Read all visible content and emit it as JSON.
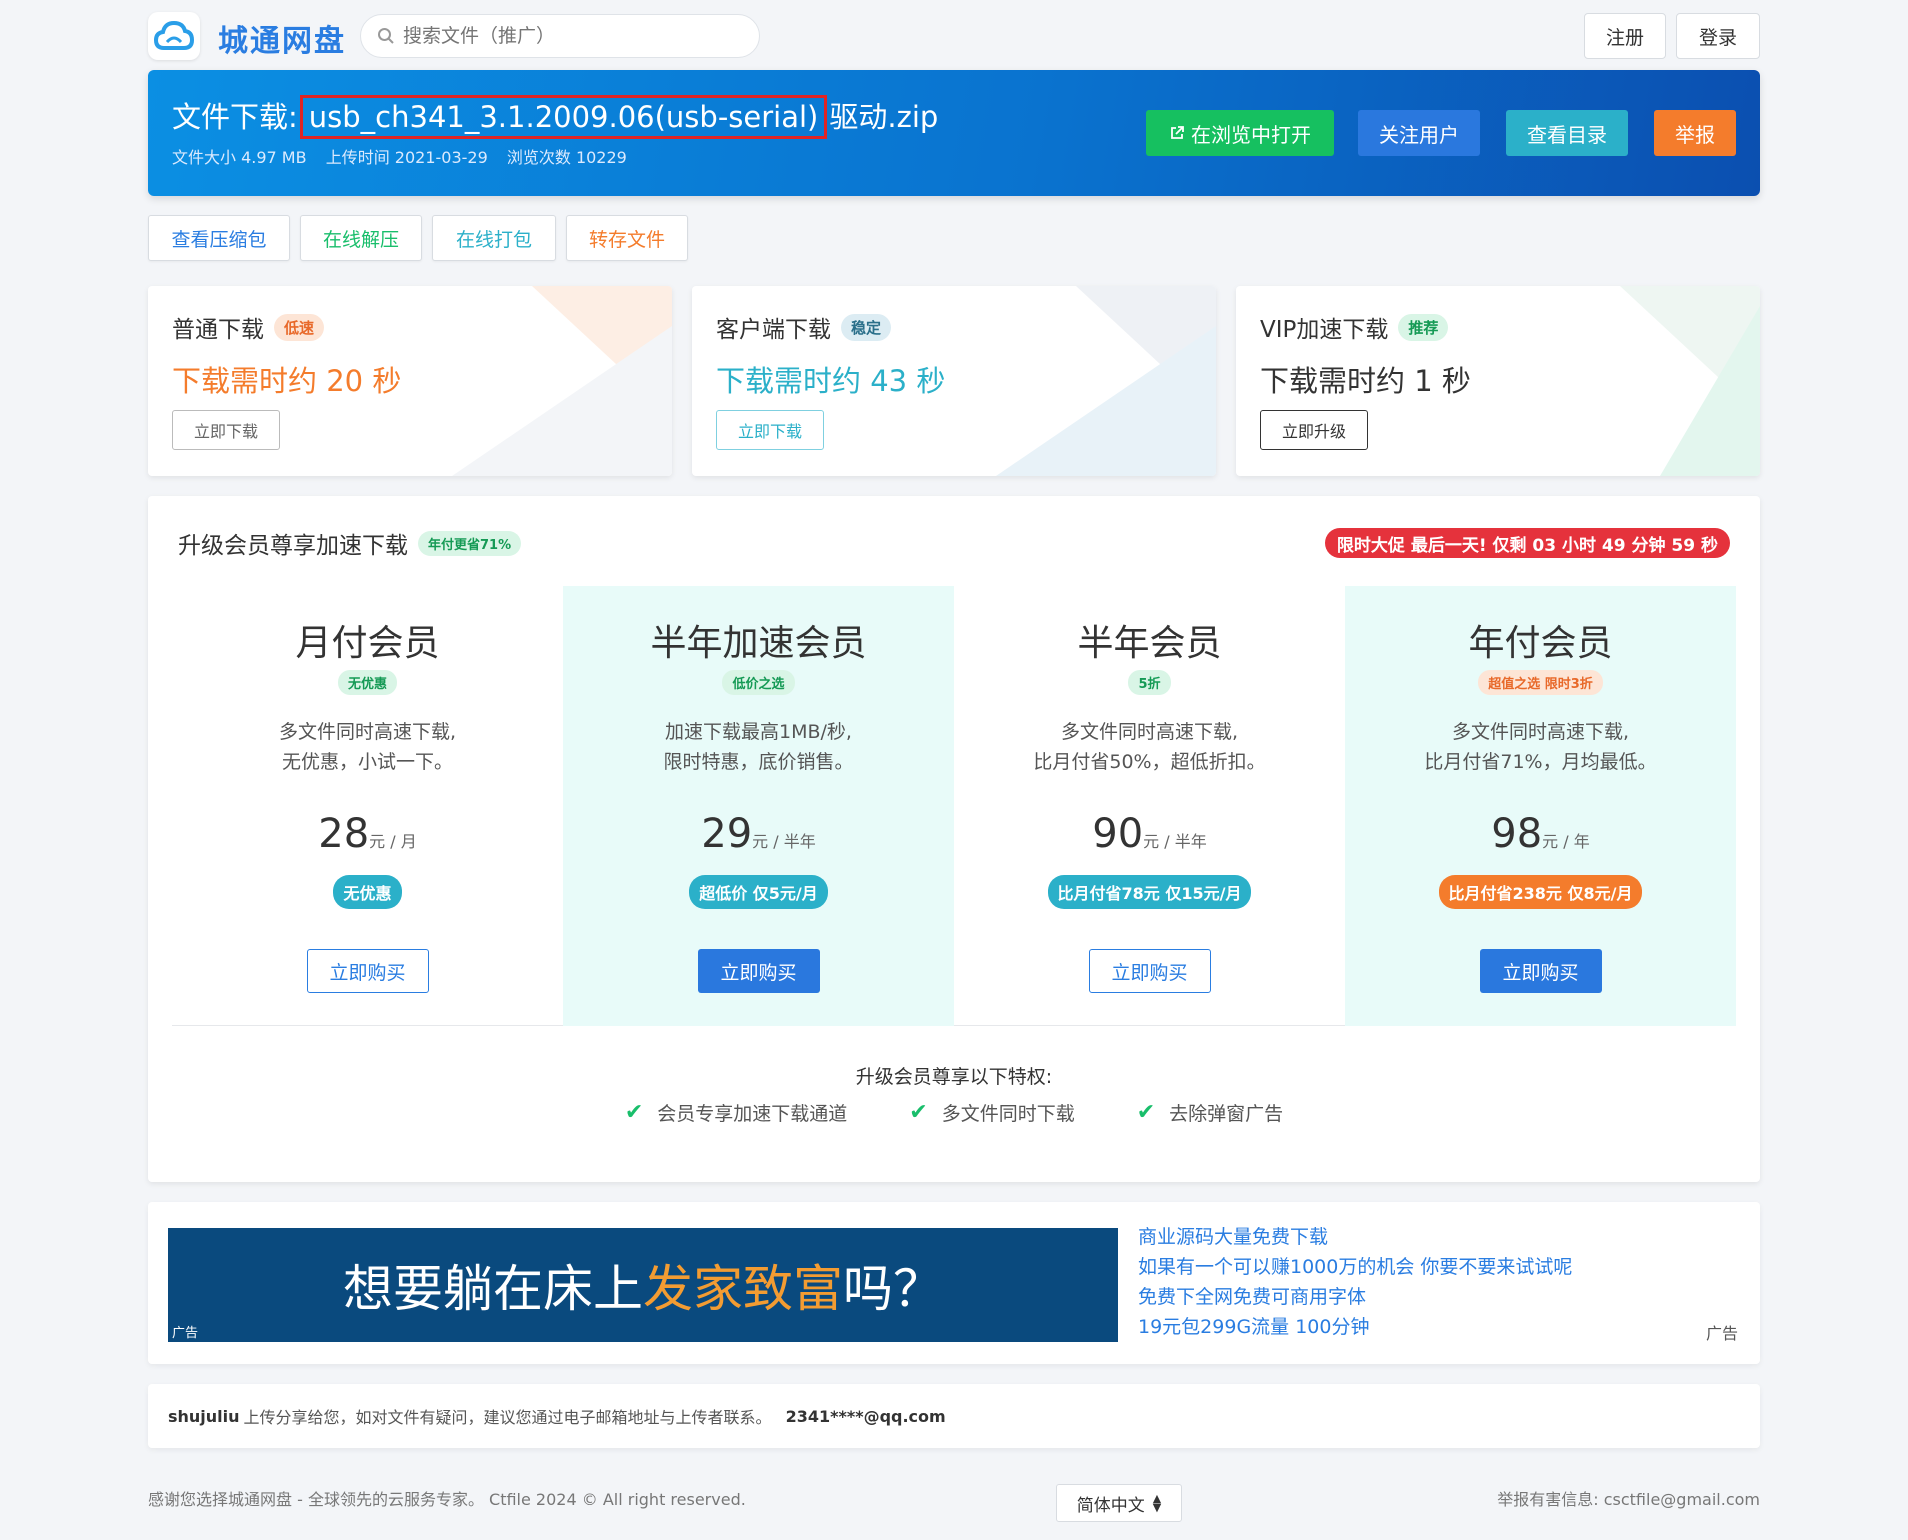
{
  "header": {
    "brand": "城通网盘",
    "search_placeholder": "搜索文件（推广）",
    "register": "注册",
    "login": "登录"
  },
  "file": {
    "title_prefix": "文件下载:",
    "name_highlight": "usb_ch341_3.1.2009.06(usb-serial)",
    "name_suffix": "驱动.zip",
    "size": "文件大小 4.97 MB",
    "upload_time": "上传时间 2021-03-29",
    "views": "浏览次数 10229"
  },
  "banner_buttons": {
    "open_browser": "在浏览中打开",
    "follow": "关注用户",
    "catalog": "查看目录",
    "report": "举报"
  },
  "tools": [
    "查看压缩包",
    "在线解压",
    "在线打包",
    "转存文件"
  ],
  "download_cards": [
    {
      "title": "普通下载",
      "tag": "低速",
      "time": "下载需时约 20 秒",
      "button": "立即下载"
    },
    {
      "title": "客户端下载",
      "tag": "稳定",
      "time": "下载需时约 43 秒",
      "button": "立即下载"
    },
    {
      "title": "VIP加速下载",
      "tag": "推荐",
      "time": "下载需时约 1 秒",
      "button": "立即升级"
    }
  ],
  "membership": {
    "title": "升级会员尊享加速下载",
    "title_tag": "年付更省71%",
    "promo": "限时大促 最后一天! 仅剩 03 小时 49 分钟 59 秒",
    "plans": [
      {
        "name": "月付会员",
        "tag": "无优惠",
        "desc1": "多文件同时高速下载,",
        "desc2": "无优惠，小试一下。",
        "price": "28",
        "unit": "元 / 月",
        "badge": "无优惠",
        "buy": "立即购买"
      },
      {
        "name": "半年加速会员",
        "tag": "低价之选",
        "desc1": "加速下载最高1MB/秒,",
        "desc2": "限时特惠，底价销售。",
        "price": "29",
        "unit": "元 / 半年",
        "badge": "超低价 仅5元/月",
        "buy": "立即购买"
      },
      {
        "name": "半年会员",
        "tag": "5折",
        "desc1": "多文件同时高速下载,",
        "desc2": "比月付省50%，超低折扣。",
        "price": "90",
        "unit": "元 / 半年",
        "badge": "比月付省78元 仅15元/月",
        "buy": "立即购买"
      },
      {
        "name": "年付会员",
        "tag": "超值之选 限时3折",
        "desc1": "多文件同时高速下载,",
        "desc2": "比月付省71%，月均最低。",
        "price": "98",
        "unit": "元 / 年",
        "badge": "比月付省238元 仅8元/月",
        "buy": "立即购买"
      }
    ],
    "benefits_title": "升级会员尊享以下特权:",
    "benefits": [
      "会员专享加速下载通道",
      "多文件同时下载",
      "去除弹窗广告"
    ]
  },
  "ad": {
    "headline_a": "想要躺在床上",
    "headline_b": "发家致富",
    "headline_c": "吗？",
    "label": "广告",
    "links": [
      "商业源码大量免费下载",
      "如果有一个可以赚1000万的机会 你要不要来试试呢",
      "免费下全网免费可商用字体",
      "19元包299G流量 100分钟"
    ],
    "label_right": "广告"
  },
  "uploader": {
    "name": "shujuliu",
    "message": "上传分享给您，如对文件有疑问，建议您通过电子邮箱地址与上传者联系。",
    "email": "2341****@qq.com"
  },
  "footer": {
    "left": "感谢您选择城通网盘 - 全球领先的云服务专家。 Ctfile 2024 © All right reserved.",
    "language": "简体中文",
    "right": "举报有害信息: csctfile@gmail.com"
  },
  "colors": {
    "accent": "#2a7de1",
    "green": "#19be6b",
    "orange": "#f47c2c",
    "teal": "#2bb0c9"
  }
}
